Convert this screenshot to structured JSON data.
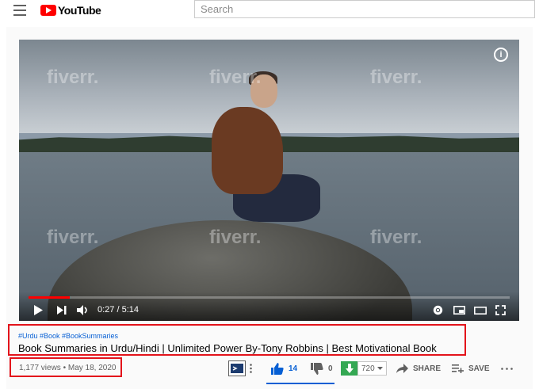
{
  "header": {
    "logo_text": "YouTube",
    "search_placeholder": "Search"
  },
  "player": {
    "watermark": "fiverr.",
    "time": "0:27 / 5:14",
    "progress_fraction": 0.086
  },
  "video": {
    "hashtags": "#Urdu #Book #BookSummaries",
    "title": "Book Summaries in Urdu/Hindi | Unlimited Power By-Tony Robbins | Best Motivational Book",
    "views_date": "1,177 views • May 18, 2020"
  },
  "actions": {
    "likes": "14",
    "dislikes": "0",
    "quality": "720",
    "share": "SHARE",
    "save": "SAVE"
  },
  "colors": {
    "accent": "#065fd4",
    "brand": "#ff0000",
    "highlight_frame": "#e3131b",
    "download": "#34a853"
  }
}
